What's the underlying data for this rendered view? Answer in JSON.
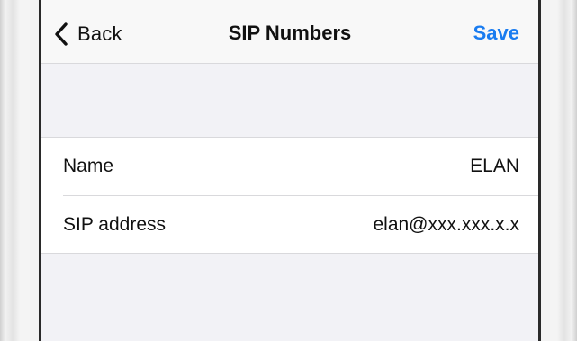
{
  "navbar": {
    "back_label": "Back",
    "title": "SIP Numbers",
    "save_label": "Save",
    "back_icon": "chevron-left-icon"
  },
  "colors": {
    "accent": "#1a7cf0",
    "background": "#f2f2f6",
    "group_background": "#ffffff",
    "separator": "#d9d9dc"
  },
  "settings": {
    "rows": [
      {
        "label": "Name",
        "value": "ELAN"
      },
      {
        "label": "SIP address",
        "value": "elan@xxx.xxx.x.x"
      }
    ]
  }
}
